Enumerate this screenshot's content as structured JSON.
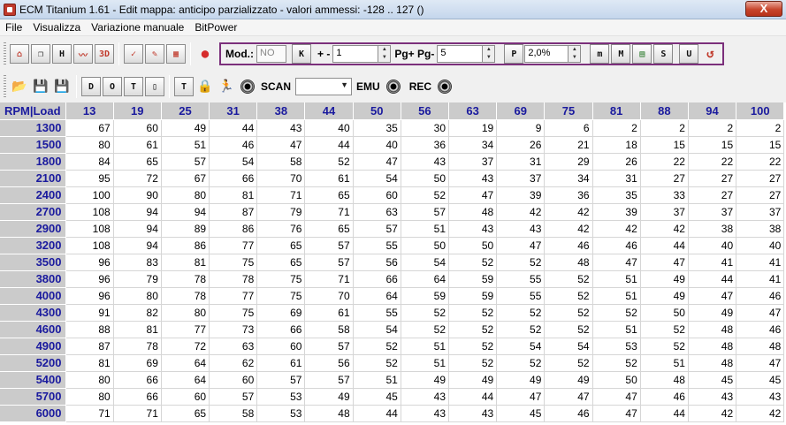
{
  "window": {
    "title": "ECM Titanium 1.61 - Edit mappa: anticipo parzializzato - valori ammessi: -128 .. 127 ()",
    "close_label": "X"
  },
  "menu": [
    "File",
    "Visualizza",
    "Variazione manuale",
    "BitPower"
  ],
  "toolbar1": {
    "buttons_left": [
      "home-icon",
      "copy-windows-icon",
      "view-h-icon",
      "graph-icon",
      "3d-icon",
      "check-icon",
      "edit-icon",
      "table-icon",
      "colors-icon"
    ],
    "mod_label": "Mod.:",
    "mod_value": "NO",
    "k_button": "K",
    "plusminus_label": "+ -",
    "plusminus_value": "1",
    "pg_label": "Pg+ Pg-",
    "pg_value": "5",
    "p_button": "P",
    "percent_value": "2,0%",
    "right_buttons": [
      "m",
      "M",
      "grid",
      "S",
      "U",
      "undo"
    ]
  },
  "toolbar2": {
    "buttons_left": [
      "open-icon",
      "save-icon",
      "save-as-icon",
      "D",
      "O",
      "T",
      "split"
    ],
    "scan_label": "SCAN",
    "scan_select": "",
    "emu_label": "EMU",
    "rec_label": "REC"
  },
  "table": {
    "corner_label": "RPM|Load",
    "columns": [
      "13",
      "19",
      "25",
      "31",
      "38",
      "44",
      "50",
      "56",
      "63",
      "69",
      "75",
      "81",
      "88",
      "94",
      "100"
    ],
    "rows": [
      {
        "rpm": "1300",
        "values": [
          67,
          60,
          49,
          44,
          43,
          40,
          35,
          30,
          19,
          9,
          6,
          2,
          2,
          2,
          2
        ]
      },
      {
        "rpm": "1500",
        "values": [
          80,
          61,
          51,
          46,
          47,
          44,
          40,
          36,
          34,
          26,
          21,
          18,
          15,
          15,
          15
        ]
      },
      {
        "rpm": "1800",
        "values": [
          84,
          65,
          57,
          54,
          58,
          52,
          47,
          43,
          37,
          31,
          29,
          26,
          22,
          22,
          22
        ]
      },
      {
        "rpm": "2100",
        "values": [
          95,
          72,
          67,
          66,
          70,
          61,
          54,
          50,
          43,
          37,
          34,
          31,
          27,
          27,
          27
        ]
      },
      {
        "rpm": "2400",
        "values": [
          100,
          90,
          80,
          81,
          71,
          65,
          60,
          52,
          47,
          39,
          36,
          35,
          33,
          27,
          27
        ]
      },
      {
        "rpm": "2700",
        "values": [
          108,
          94,
          94,
          87,
          79,
          71,
          63,
          57,
          48,
          42,
          42,
          39,
          37,
          37,
          37
        ]
      },
      {
        "rpm": "2900",
        "values": [
          108,
          94,
          89,
          86,
          76,
          65,
          57,
          51,
          43,
          43,
          42,
          42,
          42,
          38,
          38
        ]
      },
      {
        "rpm": "3200",
        "values": [
          108,
          94,
          86,
          77,
          65,
          57,
          55,
          50,
          50,
          47,
          46,
          46,
          44,
          40,
          40
        ]
      },
      {
        "rpm": "3500",
        "values": [
          96,
          83,
          81,
          75,
          65,
          57,
          56,
          54,
          52,
          52,
          48,
          47,
          47,
          41,
          41
        ]
      },
      {
        "rpm": "3800",
        "values": [
          96,
          79,
          78,
          78,
          75,
          71,
          66,
          64,
          59,
          55,
          52,
          51,
          49,
          44,
          41
        ]
      },
      {
        "rpm": "4000",
        "values": [
          96,
          80,
          78,
          77,
          75,
          70,
          64,
          59,
          59,
          55,
          52,
          51,
          49,
          47,
          46
        ]
      },
      {
        "rpm": "4300",
        "values": [
          91,
          82,
          80,
          75,
          69,
          61,
          55,
          52,
          52,
          52,
          52,
          52,
          50,
          49,
          47
        ]
      },
      {
        "rpm": "4600",
        "values": [
          88,
          81,
          77,
          73,
          66,
          58,
          54,
          52,
          52,
          52,
          52,
          51,
          52,
          48,
          46
        ]
      },
      {
        "rpm": "4900",
        "values": [
          87,
          78,
          72,
          63,
          60,
          57,
          52,
          51,
          52,
          54,
          54,
          53,
          52,
          48,
          48
        ]
      },
      {
        "rpm": "5200",
        "values": [
          81,
          69,
          64,
          62,
          61,
          56,
          52,
          51,
          52,
          52,
          52,
          52,
          51,
          48,
          47
        ]
      },
      {
        "rpm": "5400",
        "values": [
          80,
          66,
          64,
          60,
          57,
          57,
          51,
          49,
          49,
          49,
          49,
          50,
          48,
          45,
          45
        ]
      },
      {
        "rpm": "5700",
        "values": [
          80,
          66,
          60,
          57,
          53,
          49,
          45,
          43,
          44,
          47,
          47,
          47,
          46,
          43,
          43
        ]
      },
      {
        "rpm": "6000",
        "values": [
          71,
          71,
          65,
          58,
          53,
          48,
          44,
          43,
          43,
          45,
          46,
          47,
          44,
          42,
          42
        ]
      }
    ]
  }
}
